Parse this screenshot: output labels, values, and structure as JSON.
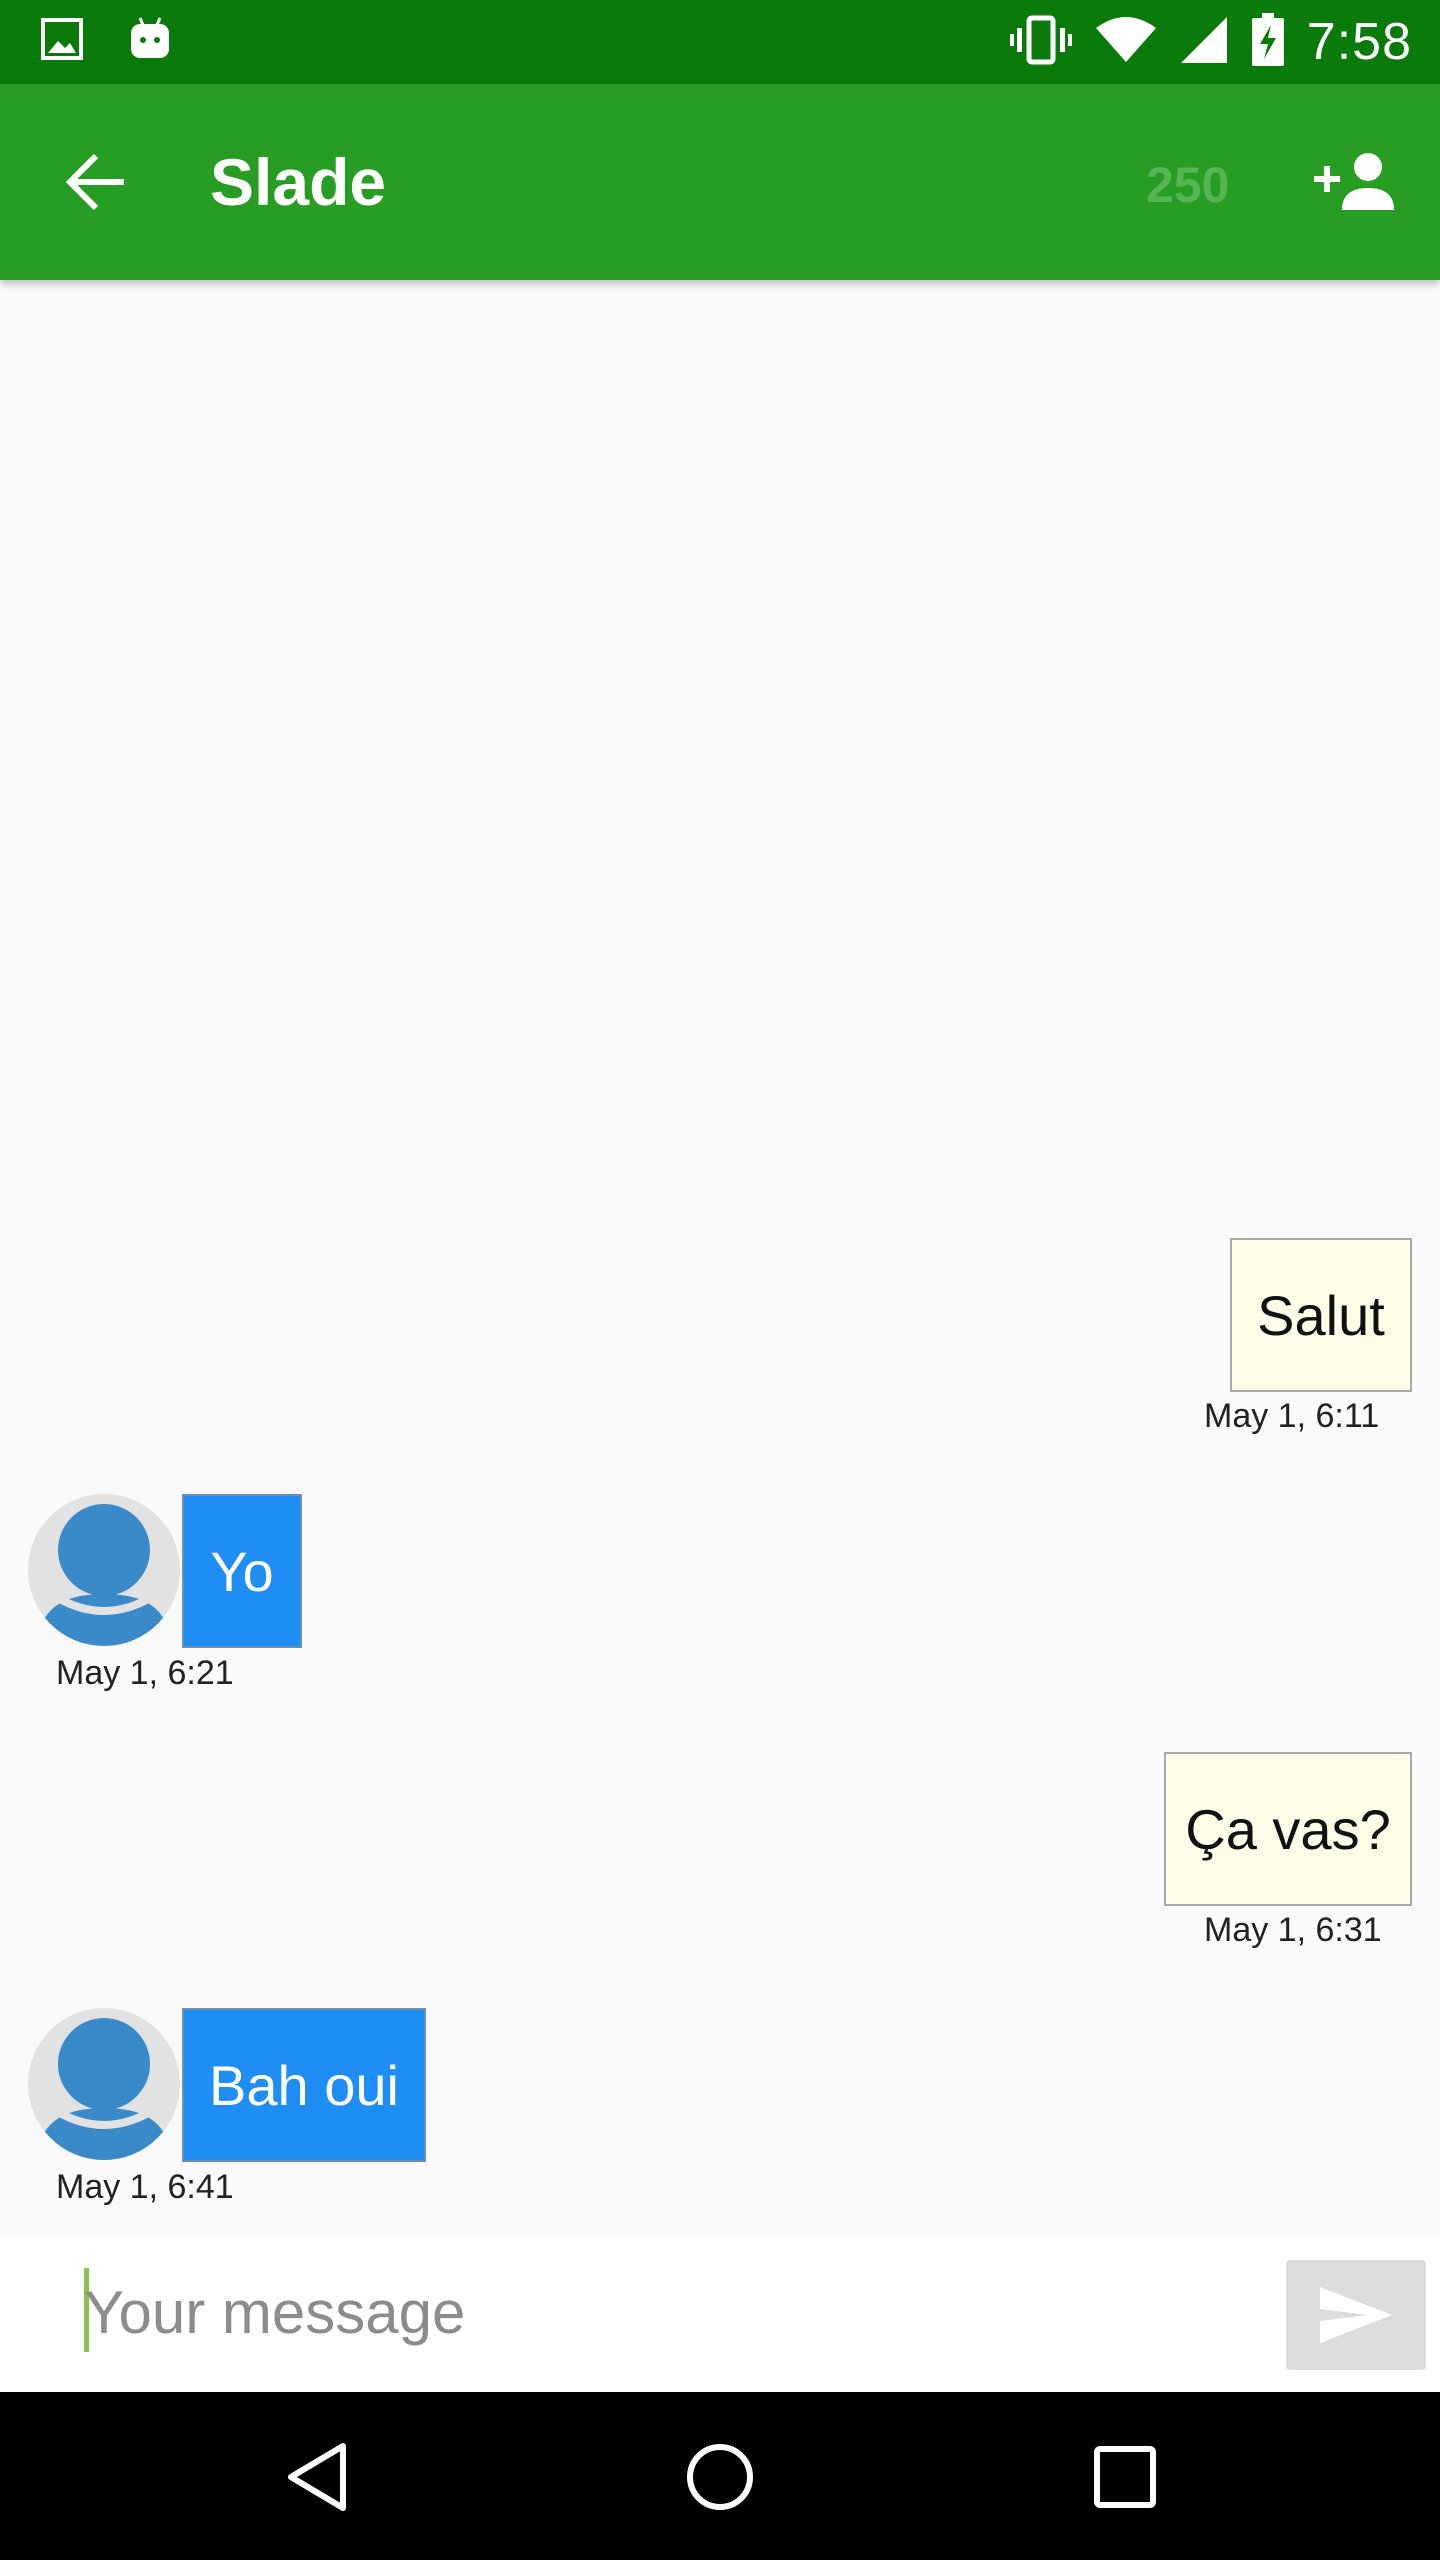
{
  "status_bar": {
    "time": "7:58",
    "left_icons": [
      "image-icon",
      "android-icon"
    ],
    "right_icons": [
      "vibrate-icon",
      "wifi-icon",
      "signal-icon",
      "battery-charging-icon"
    ]
  },
  "app_bar": {
    "title": "Slade",
    "char_count": "250",
    "back_icon": "arrow-back-icon",
    "add_icon": "person-add-icon"
  },
  "messages": [
    {
      "direction": "outgoing",
      "text": "Salut",
      "timestamp": "May 1, 6:11"
    },
    {
      "direction": "incoming",
      "text": "Yo",
      "timestamp": "May 1, 6:21"
    },
    {
      "direction": "outgoing",
      "text": "Ça vas?",
      "timestamp": "May 1, 6:31"
    },
    {
      "direction": "incoming",
      "text": "Bah oui",
      "timestamp": "May 1, 6:41"
    }
  ],
  "composer": {
    "placeholder": "Your message",
    "value": "",
    "send_icon": "send-icon"
  },
  "nav_bar": {
    "icons": [
      "back-triangle-icon",
      "home-circle-icon",
      "recents-square-icon"
    ]
  },
  "colors": {
    "status_bar": "#0a7a0a",
    "app_bar": "#279e23",
    "outgoing_bubble": "#fdfde8",
    "incoming_bubble": "#1e8ef5",
    "avatar_blue": "#3a8ac9"
  }
}
